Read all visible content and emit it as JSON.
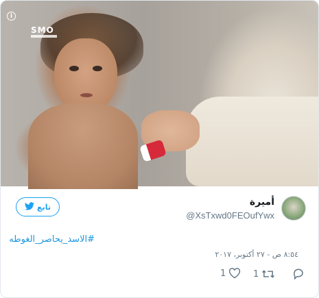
{
  "tweet": {
    "author_name": "أميرة",
    "author_handle": "@XsTxwd0FEOufYwx",
    "follow_label": "تابع",
    "hashtag": "#الاسد_يحاصر_الغوطه",
    "timestamp": "٨:٥٤ ص - ٢٧ أكتوبر، ٢٠١٧",
    "retweet_count": "1",
    "like_count": "1"
  },
  "media": {
    "watermark": "SMO",
    "info_icon": "i"
  },
  "colors": {
    "accent": "#1da1f2",
    "link": "#1b95e0",
    "muted": "#657786",
    "text": "#14171a",
    "border": "#e1e8ed"
  },
  "icons": {
    "info": "info-icon",
    "twitter": "twitter-bird-icon",
    "reply": "reply-icon",
    "retweet": "retweet-icon",
    "like": "heart-icon"
  }
}
